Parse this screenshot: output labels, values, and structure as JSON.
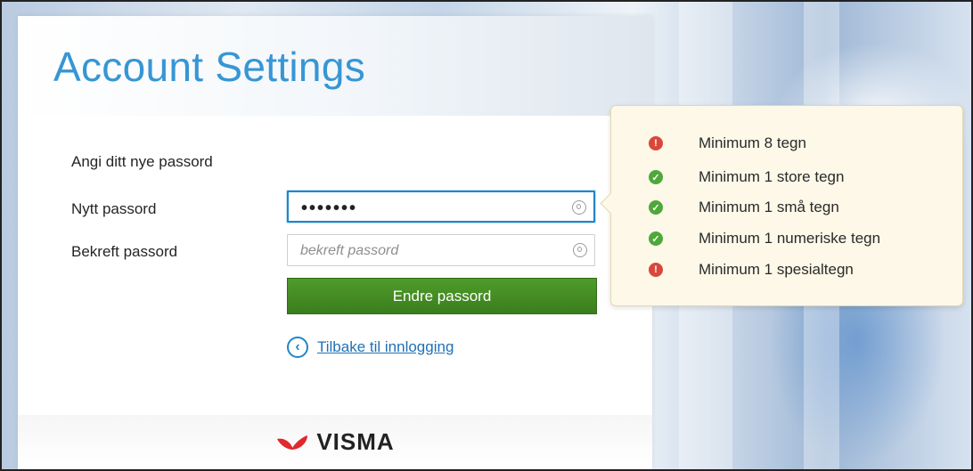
{
  "page": {
    "title": "Account Settings"
  },
  "form": {
    "intro": "Angi ditt nye passord",
    "new_password_label": "Nytt passord",
    "new_password_value": "•••••••",
    "confirm_password_label": "Bekreft passord",
    "confirm_password_placeholder": "bekreft passord",
    "submit_label": "Endre passord",
    "back_label": "Tilbake til innlogging"
  },
  "footer": {
    "brand": "VISMA",
    "brand_color": "#e0282e"
  },
  "requirements": [
    {
      "label": "Minimum 8 tegn",
      "status": "fail",
      "icon": "!"
    },
    {
      "label": "Minimum 1 store tegn",
      "status": "pass",
      "icon": "✓"
    },
    {
      "label": "Minimum 1 små tegn",
      "status": "pass",
      "icon": "✓"
    },
    {
      "label": "Minimum 1 numeriske tegn",
      "status": "pass",
      "icon": "✓"
    },
    {
      "label": "Minimum 1 spesialtegn",
      "status": "fail",
      "icon": "!"
    }
  ],
  "colors": {
    "accent": "#1f86c8",
    "button": "#3f8420",
    "fail": "#d9473b",
    "pass": "#4ea83a"
  }
}
